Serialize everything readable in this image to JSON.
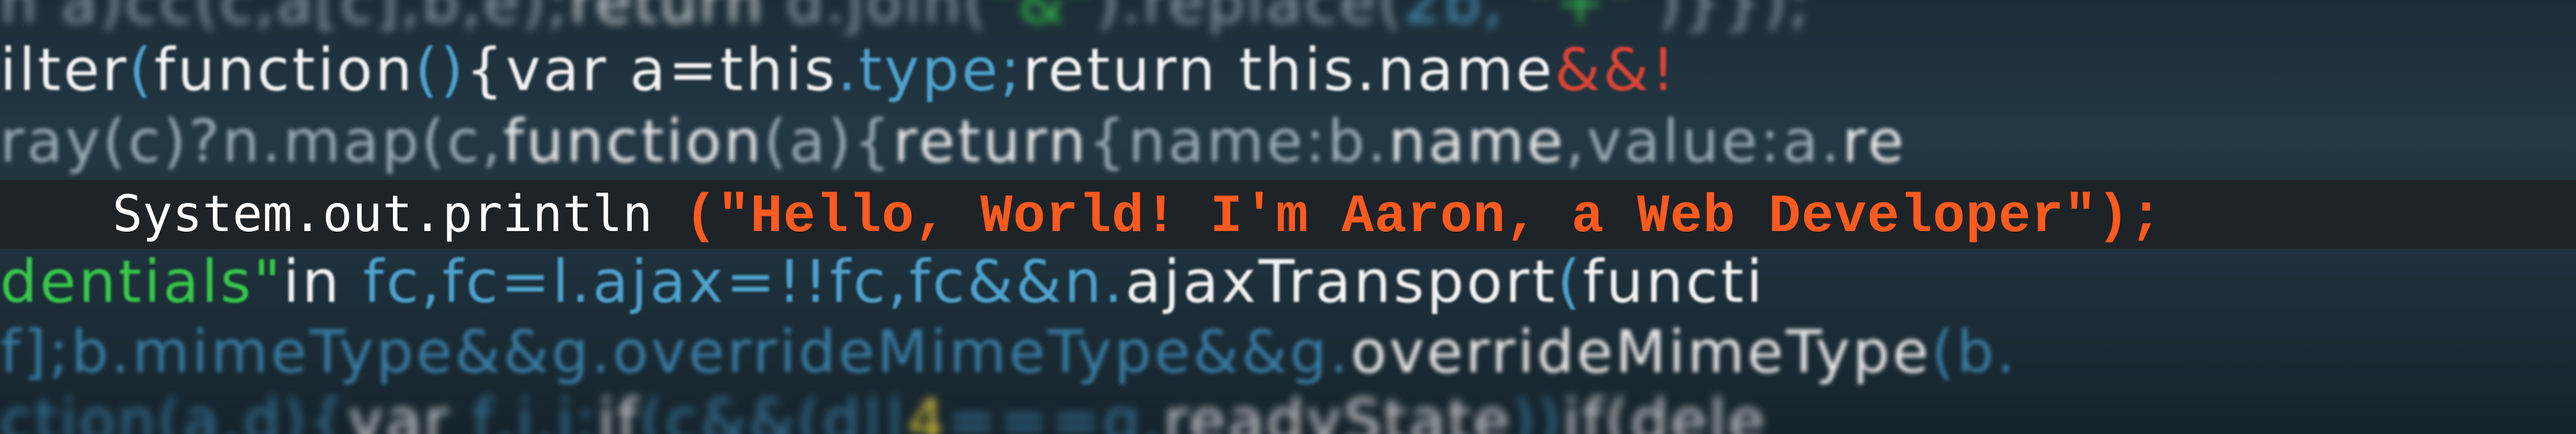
{
  "hero": {
    "method": "System.out.println",
    "message": "(\"Hello, World! I'm Aaron, a Web Developer\");"
  },
  "background_code": {
    "line1": [
      {
        "text": "n a)cc(c,a[c],b,e);",
        "color": "grey"
      },
      {
        "text": "return ",
        "color": "white"
      },
      {
        "text": "d.join(",
        "color": "grey"
      },
      {
        "text": "\"&\"",
        "color": "green"
      },
      {
        "text": ").replace(",
        "color": "grey"
      },
      {
        "text": "2b,",
        "color": "blue"
      },
      {
        "text": " \"+\" ",
        "color": "green"
      },
      {
        "text": ")}});",
        "color": "grey"
      }
    ],
    "line2": [
      {
        "text": "ilter",
        "color": "white"
      },
      {
        "text": "(",
        "color": "blue"
      },
      {
        "text": "function",
        "color": "white"
      },
      {
        "text": "()",
        "color": "blue"
      },
      {
        "text": "{",
        "color": "white"
      },
      {
        "text": "var ",
        "color": "white"
      },
      {
        "text": "a=this",
        "color": "white"
      },
      {
        "text": ".type;",
        "color": "blue"
      },
      {
        "text": "return this",
        "color": "white"
      },
      {
        "text": ".name",
        "color": "white"
      },
      {
        "text": "&&!",
        "color": "red"
      }
    ],
    "line3": [
      {
        "text": "ray(c)?n.map(c,",
        "color": "grey"
      },
      {
        "text": "function",
        "color": "white"
      },
      {
        "text": "(a){",
        "color": "grey"
      },
      {
        "text": "return",
        "color": "white"
      },
      {
        "text": "{name:b.",
        "color": "grey"
      },
      {
        "text": "name",
        "color": "white"
      },
      {
        "text": ",value:a.",
        "color": "grey"
      },
      {
        "text": "re",
        "color": "white"
      }
    ],
    "line4": [
      {
        "text": "dentials\"",
        "color": "green"
      },
      {
        "text": "in ",
        "color": "white"
      },
      {
        "text": "fc,fc=l.ajax=!!fc,fc&&n.",
        "color": "blue"
      },
      {
        "text": "ajaxTransport",
        "color": "white"
      },
      {
        "text": "(",
        "color": "blue"
      },
      {
        "text": "functi",
        "color": "white"
      }
    ],
    "line5": [
      {
        "text": "f];b.mimeType&&g.overrideMimeType&&g.",
        "color": "dblue"
      },
      {
        "text": "overrideMimeType",
        "color": "white"
      },
      {
        "text": "(b.",
        "color": "dblue"
      }
    ],
    "line6": [
      {
        "text": "ction(a,d){",
        "color": "dblue"
      },
      {
        "text": "var ",
        "color": "white"
      },
      {
        "text": "f,i,j;",
        "color": "dblue"
      },
      {
        "text": "if",
        "color": "white"
      },
      {
        "text": "(c&&(d||",
        "color": "dblue"
      },
      {
        "text": "4",
        "color": "yellow"
      },
      {
        "text": "===g.",
        "color": "dblue"
      },
      {
        "text": "readyState",
        "color": "white"
      },
      {
        "text": "))",
        "color": "dblue"
      },
      {
        "text": "if",
        "color": "white"
      },
      {
        "text": "(dele",
        "color": "white"
      }
    ]
  }
}
